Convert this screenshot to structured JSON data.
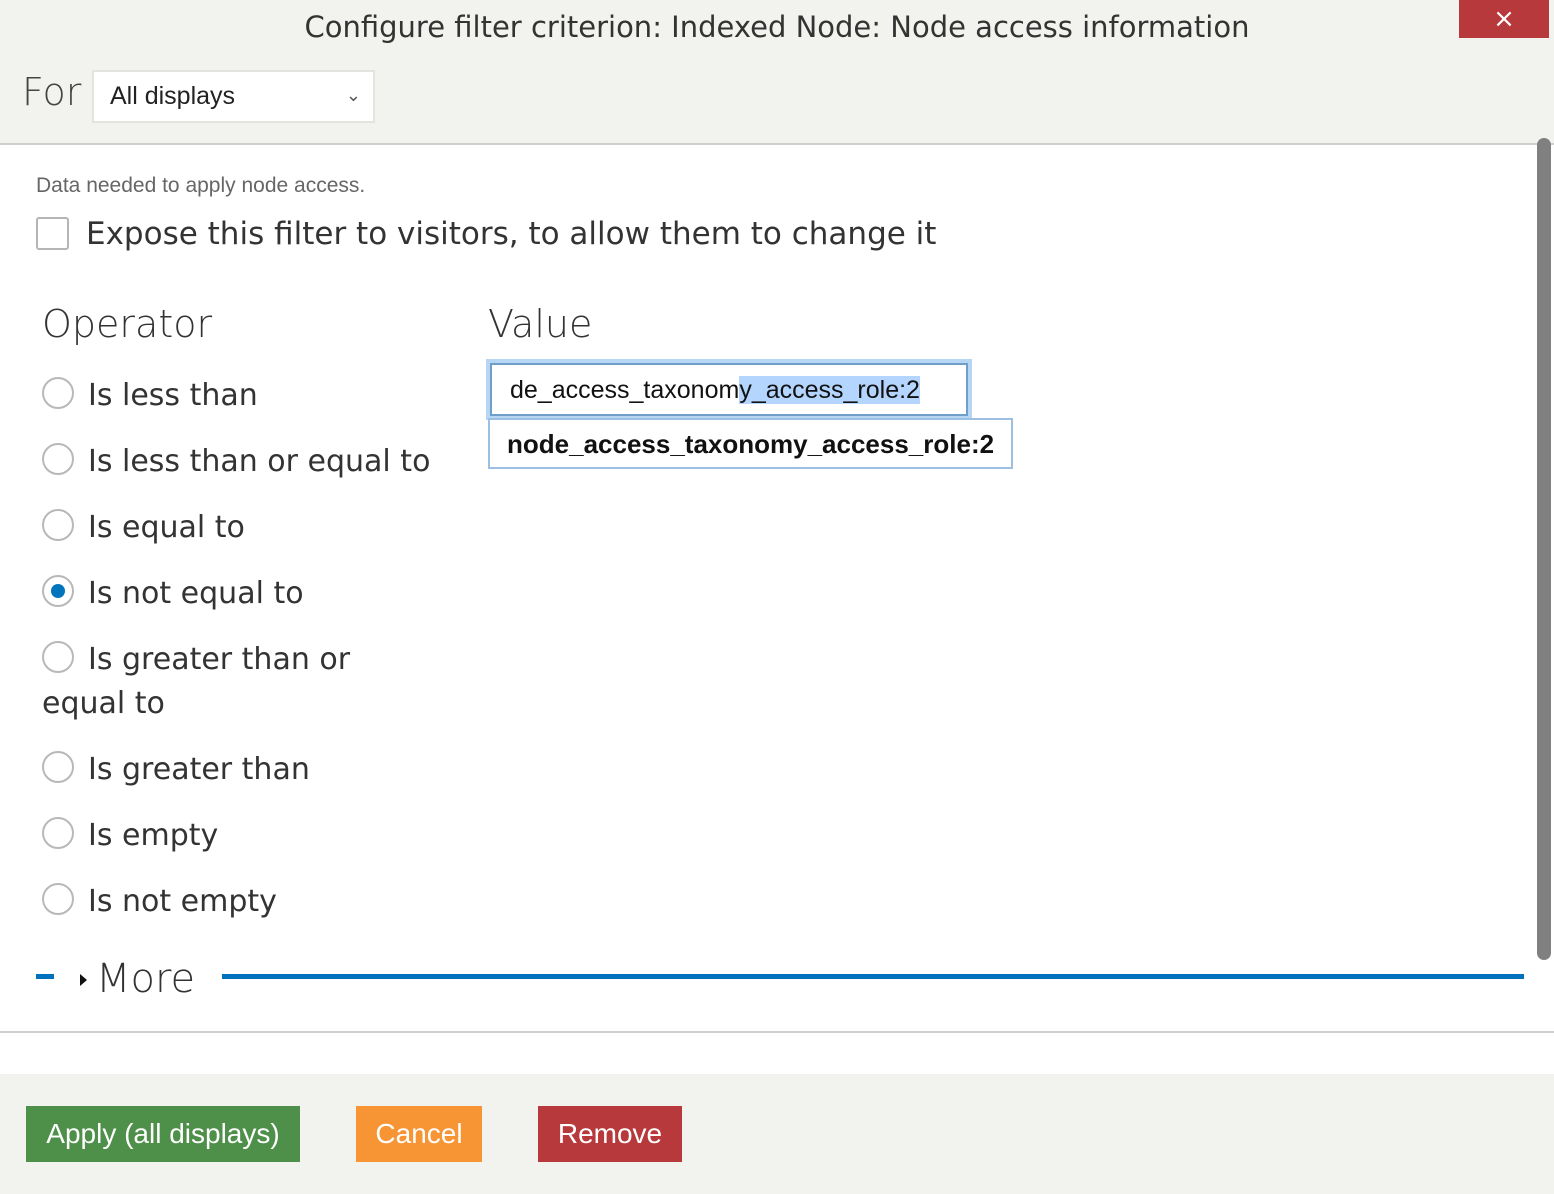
{
  "dialog": {
    "title": "Configure filter criterion: Indexed Node: Node access information",
    "close_icon": "×"
  },
  "for_select": {
    "label": "For",
    "value": "All displays",
    "chevron": "⌄"
  },
  "description": "Data needed to apply node access.",
  "expose_checkbox": {
    "label": "Expose this filter to visitors, to allow them to change it",
    "checked": false
  },
  "operator": {
    "heading": "Operator",
    "options": [
      {
        "label": "Is less than",
        "checked": false
      },
      {
        "label": "Is less than or equal to",
        "checked": false
      },
      {
        "label": "Is equal to",
        "checked": false
      },
      {
        "label": "Is not equal to",
        "checked": true
      },
      {
        "label": "Is greater than or equal to",
        "checked": false
      },
      {
        "label": "Is greater than",
        "checked": false
      },
      {
        "label": "Is empty",
        "checked": false
      },
      {
        "label": "Is not empty",
        "checked": false
      }
    ]
  },
  "value": {
    "heading": "Value",
    "input_text_unselected": "de_access_taxonom",
    "input_text_selected": "y_access_role:2",
    "autocomplete_suggestion": "node_access_taxonomy_access_role:2"
  },
  "more": {
    "label": "More"
  },
  "buttons": {
    "apply": "Apply (all displays)",
    "cancel": "Cancel",
    "remove": "Remove"
  },
  "colors": {
    "apply": "#4e8f49",
    "cancel": "#f79433",
    "remove": "#b8393b",
    "accent": "#0071bc"
  }
}
